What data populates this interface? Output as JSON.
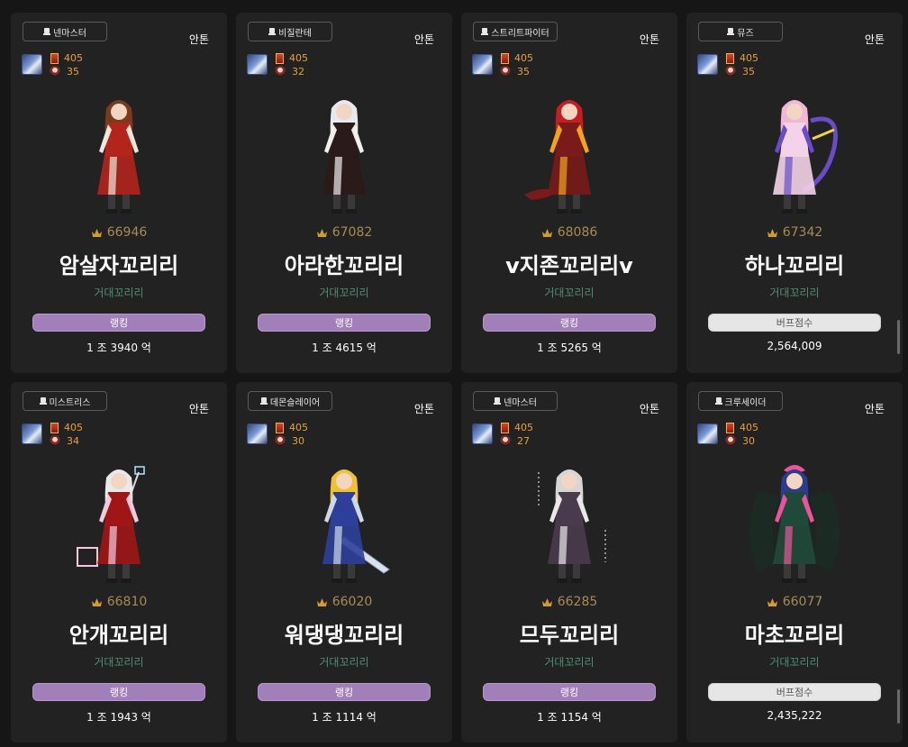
{
  "cards": [
    {
      "job": "넨마스터",
      "server": "안톤",
      "stat_a": "405",
      "stat_b": "35",
      "score": "66946",
      "name": "암살자꼬리리",
      "guild": "거대꼬리리",
      "button": "랭킹",
      "button_style": "purple",
      "value": "1 조 3940 억",
      "sprite": "assassin",
      "palette": {
        "main": "#b3241c",
        "accent": "#f1e6d8",
        "hair": "#7a3b1c"
      }
    },
    {
      "job": "비질란테",
      "server": "안톤",
      "stat_a": "405",
      "stat_b": "32",
      "score": "67082",
      "name": "아라한꼬리리",
      "guild": "거대꼬리리",
      "button": "랭킹",
      "button_style": "purple",
      "value": "1 조 4615 억",
      "sprite": "arahan",
      "palette": {
        "main": "#2b1a1a",
        "accent": "#f0efee",
        "hair": "#e8e8ef"
      }
    },
    {
      "job": "스트리트파이터",
      "server": "안톤",
      "stat_a": "405",
      "stat_b": "35",
      "score": "68086",
      "name": "v지존꼬리리v",
      "guild": "거대꼬리리",
      "button": "랭킹",
      "button_style": "purple",
      "value": "1 조 5265 억",
      "sprite": "fighter",
      "palette": {
        "main": "#7a1a1a",
        "accent": "#f2a51c",
        "hair": "#c51e1e"
      }
    },
    {
      "job": "뮤즈",
      "server": "안톤",
      "stat_a": "405",
      "stat_b": "35",
      "score": "67342",
      "name": "하나꼬리리",
      "guild": "거대꼬리리",
      "button": "버프점수",
      "button_style": "light",
      "value": "2,564,009",
      "sprite": "muse",
      "palette": {
        "main": "#f4d3ea",
        "accent": "#6a4bc8",
        "hair": "#f2b6d8"
      }
    },
    {
      "job": "미스트리스",
      "server": "안톤",
      "stat_a": "405",
      "stat_b": "34",
      "score": "66810",
      "name": "안개꼬리리",
      "guild": "거대꼬리리",
      "button": "랭킹",
      "button_style": "purple",
      "value": "1 조 1943 억",
      "sprite": "mistress",
      "palette": {
        "main": "#a01616",
        "accent": "#f4c9e0",
        "hair": "#e9e9e9"
      }
    },
    {
      "job": "데몬슬레이어",
      "server": "안톤",
      "stat_a": "405",
      "stat_b": "30",
      "score": "66020",
      "name": "워댕댕꼬리리",
      "guild": "거대꼬리리",
      "button": "랭킹",
      "button_style": "purple",
      "value": "1 조 1114 억",
      "sprite": "slayer",
      "palette": {
        "main": "#2e3f9a",
        "accent": "#cfd8e6",
        "hair": "#f0c232"
      }
    },
    {
      "job": "넨마스터",
      "server": "안톤",
      "stat_a": "405",
      "stat_b": "27",
      "score": "66285",
      "name": "므두꼬리리",
      "guild": "거대꼬리리",
      "button": "랭킹",
      "button_style": "purple",
      "value": "1 조 1154 억",
      "sprite": "nen",
      "palette": {
        "main": "#4a3a4e",
        "accent": "#e8e8e8",
        "hair": "#d6d6d6"
      }
    },
    {
      "job": "크루세이더",
      "server": "안톤",
      "stat_a": "405",
      "stat_b": "30",
      "score": "66077",
      "name": "마초꼬리리",
      "guild": "거대꼬리리",
      "button": "버프점수",
      "button_style": "light",
      "value": "2,435,222",
      "sprite": "crusader",
      "palette": {
        "main": "#1f4a3a",
        "accent": "#e9549a",
        "hair": "#2a3c8a"
      }
    }
  ]
}
